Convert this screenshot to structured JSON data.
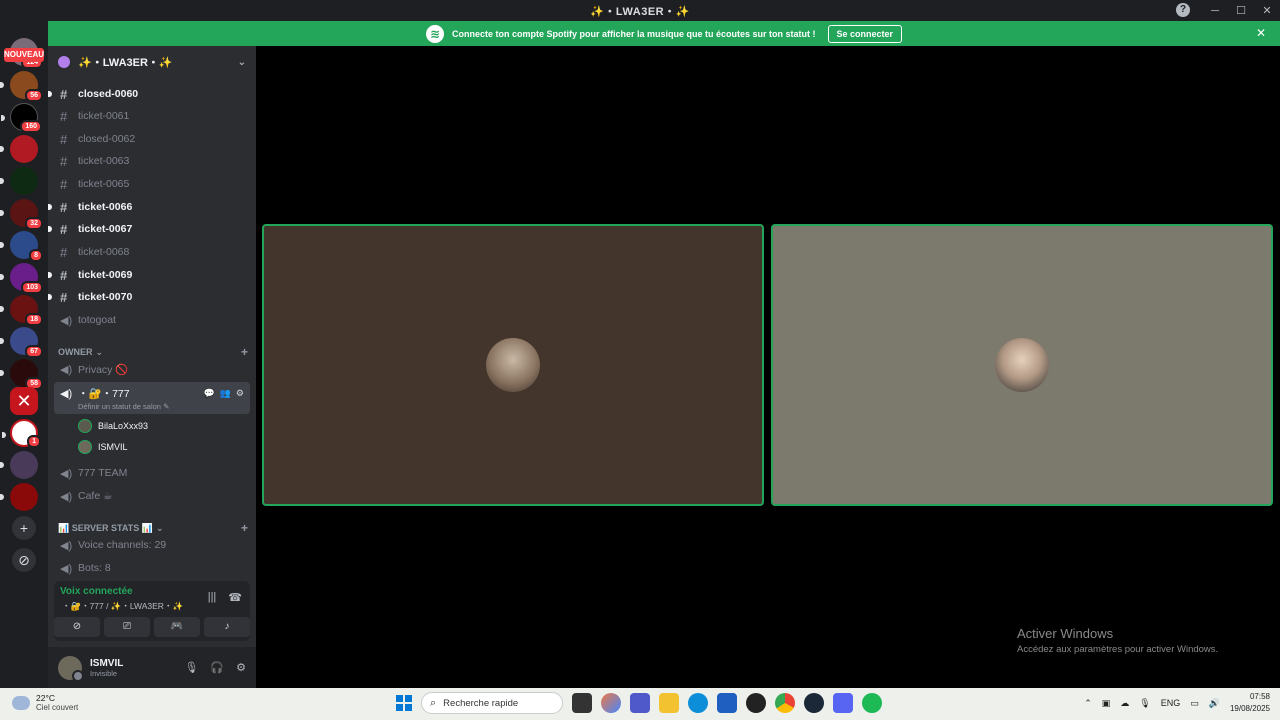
{
  "window": {
    "title": "✨・LWA3ER・✨"
  },
  "banner": {
    "text": "Connecte ton compte Spotify pour afficher la musique que tu écoutes sur ton statut !",
    "button": "Se connecter"
  },
  "servers": {
    "new_label": "NOUVEAU",
    "badges": [
      "124",
      "56",
      "160",
      "32",
      "8",
      "103",
      "18",
      "67",
      "58",
      "1"
    ]
  },
  "guild": {
    "name": "✨・LWA3ER・✨"
  },
  "channels": [
    {
      "name": "closed-0060",
      "unread": true
    },
    {
      "name": "ticket-0061",
      "unread": false
    },
    {
      "name": "closed-0062",
      "unread": false
    },
    {
      "name": "ticket-0063",
      "unread": false
    },
    {
      "name": "ticket-0065",
      "unread": false
    },
    {
      "name": "ticket-0066",
      "unread": true
    },
    {
      "name": "ticket-0067",
      "unread": true
    },
    {
      "name": "ticket-0068",
      "unread": false
    },
    {
      "name": "ticket-0069",
      "unread": true
    },
    {
      "name": "ticket-0070",
      "unread": true
    },
    {
      "name": "totogoat",
      "unread": false
    }
  ],
  "owner_category": {
    "label": "OWNER",
    "privacy": "Privacy 🚫",
    "active_channel": "・🔐・777",
    "active_status": "Définir un statut de salon",
    "members": [
      "BilaLoXxx93",
      "ISMVIL"
    ],
    "team": "777 TEAM",
    "cafe": "Cafe ☕"
  },
  "stats_category": {
    "label": "📊 SERVER STATS 📊",
    "voice_channels": "Voice channels: 29",
    "bots": "Bots: 8"
  },
  "voice": {
    "status": "Voix connectée",
    "location": "・🔐・777 / ✨・LWA3ER・✨"
  },
  "user": {
    "name": "ISMVIL",
    "status": "Invisible"
  },
  "stage_colors": {
    "tile1": "#43352b",
    "tile2": "#7c7a6c",
    "accent": "#23a55a"
  },
  "activation": {
    "title": "Activer Windows",
    "subtitle": "Accédez aux paramètres pour activer Windows."
  },
  "taskbar": {
    "temp": "22°C",
    "weather": "Ciel couvert",
    "search": "Recherche rapide",
    "lang": "ENG",
    "time": "07:58",
    "date": "19/08/2025"
  }
}
